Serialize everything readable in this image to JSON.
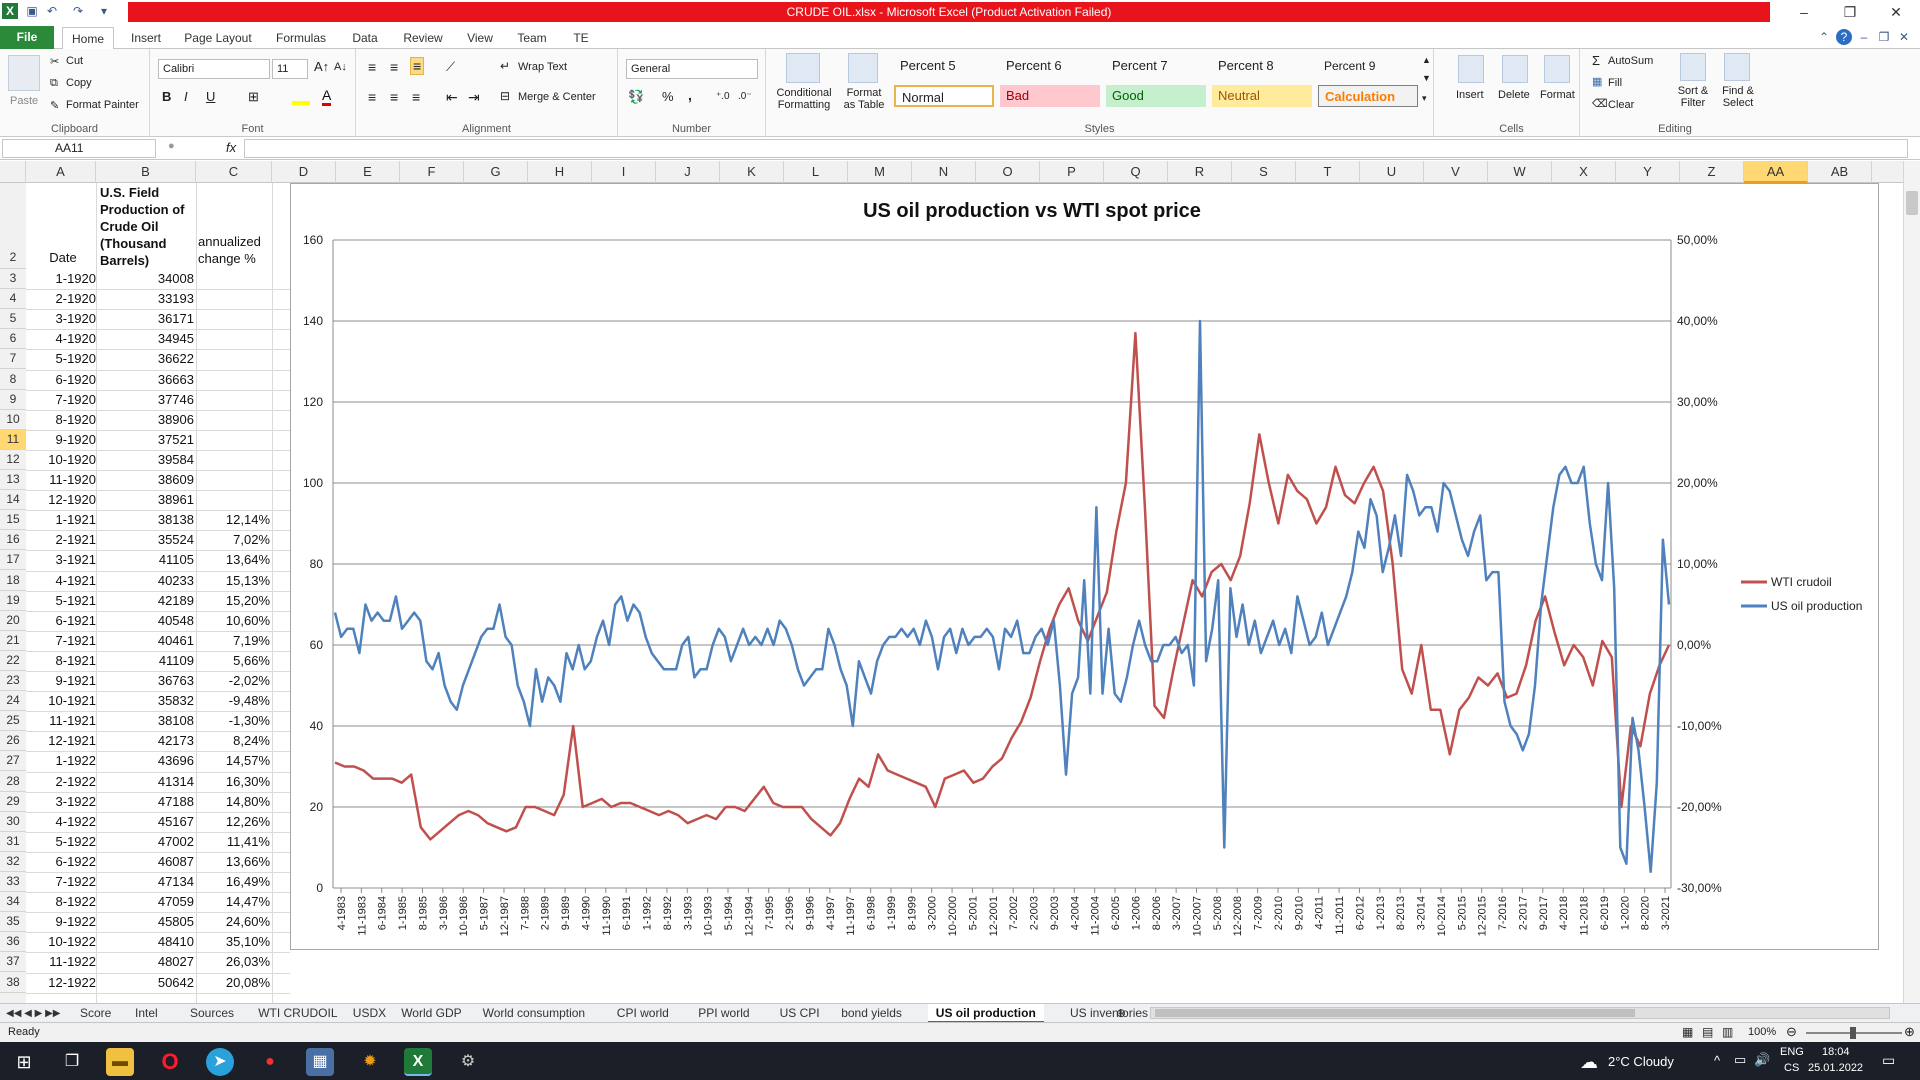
{
  "window": {
    "title": "CRUDE OIL.xlsx - Microsoft Excel (Product Activation Failed)",
    "controls": [
      "–",
      "❐",
      "✕"
    ]
  },
  "tabs": [
    "File",
    "Home",
    "Insert",
    "Page Layout",
    "Formulas",
    "Data",
    "Review",
    "View",
    "Team",
    "TE"
  ],
  "ribbon": {
    "clipboard": {
      "paste": "Paste",
      "cut": "Cut",
      "copy": "Copy",
      "format_painter": "Format Painter",
      "label": "Clipboard"
    },
    "font": {
      "name": "Calibri",
      "size": "11",
      "bold": "B",
      "italic": "I",
      "underline": "U",
      "label": "Font"
    },
    "alignment": {
      "wrap": "Wrap Text",
      "merge": "Merge & Center",
      "label": "Alignment"
    },
    "number": {
      "format": "General",
      "percent": "%",
      "comma": ",",
      "label": "Number"
    },
    "styles": {
      "conditional": "Conditional Formatting",
      "format_table": "Format as Table",
      "label": "Styles",
      "items": [
        {
          "name": "Percent 5",
          "bg": "#ffffff",
          "fg": "#111111"
        },
        {
          "name": "Percent 6",
          "bg": "#ffffff",
          "fg": "#111111"
        },
        {
          "name": "Percent 7",
          "bg": "#ffffff",
          "fg": "#111111"
        },
        {
          "name": "Percent 8",
          "bg": "#ffffff",
          "fg": "#111111"
        },
        {
          "name": "Percent 9",
          "bg": "#ffffff",
          "fg": "#111111"
        },
        {
          "name": "Normal",
          "bg": "#ffffff",
          "fg": "#111111"
        },
        {
          "name": "Bad",
          "bg": "#ffc7ce",
          "fg": "#9c0006"
        },
        {
          "name": "Good",
          "bg": "#c6efce",
          "fg": "#006100"
        },
        {
          "name": "Neutral",
          "bg": "#ffeb9c",
          "fg": "#9c5700"
        },
        {
          "name": "Calculation",
          "bg": "#f2f2f2",
          "fg": "#fa7d00"
        }
      ]
    },
    "cells": {
      "insert": "Insert",
      "delete": "Delete",
      "format": "Format",
      "label": "Cells"
    },
    "editing": {
      "autosum": "AutoSum",
      "fill": "Fill",
      "clear": "Clear",
      "sort": "Sort & Filter",
      "find": "Find & Select",
      "label": "Editing"
    }
  },
  "namebox": "AA11",
  "fx": "fx",
  "columns": [
    "A",
    "B",
    "C",
    "D",
    "E",
    "F",
    "G",
    "H",
    "I",
    "J",
    "K",
    "L",
    "M",
    "N",
    "O",
    "P",
    "Q",
    "R",
    "S",
    "T",
    "U",
    "V",
    "W",
    "X",
    "Y",
    "Z",
    "AA",
    "AB"
  ],
  "headers": {
    "A": "Date",
    "B": "U.S. Field Production of Crude Oil (Thousand Barrels)",
    "C": "annualized change %"
  },
  "rows": [
    {
      "n": "3",
      "a": "1-1920",
      "b": "34008",
      "c": ""
    },
    {
      "n": "4",
      "a": "2-1920",
      "b": "33193",
      "c": ""
    },
    {
      "n": "5",
      "a": "3-1920",
      "b": "36171",
      "c": ""
    },
    {
      "n": "6",
      "a": "4-1920",
      "b": "34945",
      "c": ""
    },
    {
      "n": "7",
      "a": "5-1920",
      "b": "36622",
      "c": ""
    },
    {
      "n": "8",
      "a": "6-1920",
      "b": "36663",
      "c": ""
    },
    {
      "n": "9",
      "a": "7-1920",
      "b": "37746",
      "c": ""
    },
    {
      "n": "10",
      "a": "8-1920",
      "b": "38906",
      "c": ""
    },
    {
      "n": "11",
      "a": "9-1920",
      "b": "37521",
      "c": ""
    },
    {
      "n": "12",
      "a": "10-1920",
      "b": "39584",
      "c": ""
    },
    {
      "n": "13",
      "a": "11-1920",
      "b": "38609",
      "c": ""
    },
    {
      "n": "14",
      "a": "12-1920",
      "b": "38961",
      "c": ""
    },
    {
      "n": "15",
      "a": "1-1921",
      "b": "38138",
      "c": "12,14%"
    },
    {
      "n": "16",
      "a": "2-1921",
      "b": "35524",
      "c": "7,02%"
    },
    {
      "n": "17",
      "a": "3-1921",
      "b": "41105",
      "c": "13,64%"
    },
    {
      "n": "18",
      "a": "4-1921",
      "b": "40233",
      "c": "15,13%"
    },
    {
      "n": "19",
      "a": "5-1921",
      "b": "42189",
      "c": "15,20%"
    },
    {
      "n": "20",
      "a": "6-1921",
      "b": "40548",
      "c": "10,60%"
    },
    {
      "n": "21",
      "a": "7-1921",
      "b": "40461",
      "c": "7,19%"
    },
    {
      "n": "22",
      "a": "8-1921",
      "b": "41109",
      "c": "5,66%"
    },
    {
      "n": "23",
      "a": "9-1921",
      "b": "36763",
      "c": "-2,02%"
    },
    {
      "n": "24",
      "a": "10-1921",
      "b": "35832",
      "c": "-9,48%"
    },
    {
      "n": "25",
      "a": "11-1921",
      "b": "38108",
      "c": "-1,30%"
    },
    {
      "n": "26",
      "a": "12-1921",
      "b": "42173",
      "c": "8,24%"
    },
    {
      "n": "27",
      "a": "1-1922",
      "b": "43696",
      "c": "14,57%"
    },
    {
      "n": "28",
      "a": "2-1922",
      "b": "41314",
      "c": "16,30%"
    },
    {
      "n": "29",
      "a": "3-1922",
      "b": "47188",
      "c": "14,80%"
    },
    {
      "n": "30",
      "a": "4-1922",
      "b": "45167",
      "c": "12,26%"
    },
    {
      "n": "31",
      "a": "5-1922",
      "b": "47002",
      "c": "11,41%"
    },
    {
      "n": "32",
      "a": "6-1922",
      "b": "46087",
      "c": "13,66%"
    },
    {
      "n": "33",
      "a": "7-1922",
      "b": "47134",
      "c": "16,49%"
    },
    {
      "n": "34",
      "a": "8-1922",
      "b": "47059",
      "c": "14,47%"
    },
    {
      "n": "35",
      "a": "9-1922",
      "b": "45805",
      "c": "24,60%"
    },
    {
      "n": "36",
      "a": "10-1922",
      "b": "48410",
      "c": "35,10%"
    },
    {
      "n": "37",
      "a": "11-1922",
      "b": "48027",
      "c": "26,03%"
    },
    {
      "n": "38",
      "a": "12-1922",
      "b": "50642",
      "c": "20,08%"
    }
  ],
  "chart_data": {
    "type": "line",
    "title": "US oil production vs WTI spot price",
    "y_left": {
      "min": 0,
      "max": 160,
      "ticks": [
        "0",
        "20",
        "40",
        "60",
        "80",
        "100",
        "120",
        "140",
        "160"
      ]
    },
    "y_right": {
      "min": -30,
      "max": 50,
      "ticks": [
        "-30,00%",
        "-20,00%",
        "-10,00%",
        "0,00%",
        "10,00%",
        "20,00%",
        "30,00%",
        "40,00%",
        "50,00%"
      ]
    },
    "x_tick_labels": [
      "4-1983",
      "11-1983",
      "6-1984",
      "1-1985",
      "8-1985",
      "3-1986",
      "10-1986",
      "5-1987",
      "12-1987",
      "7-1988",
      "2-1989",
      "9-1989",
      "4-1990",
      "11-1990",
      "6-1991",
      "1-1992",
      "8-1992",
      "3-1993",
      "10-1993",
      "5-1994",
      "12-1994",
      "7-1995",
      "2-1996",
      "9-1996",
      "4-1997",
      "11-1997",
      "6-1998",
      "1-1999",
      "8-1999",
      "3-2000",
      "10-2000",
      "5-2001",
      "12-2001",
      "7-2002",
      "2-2003",
      "9-2003",
      "4-2004",
      "11-2004",
      "6-2005",
      "1-2006",
      "8-2006",
      "3-2007",
      "10-2007",
      "5-2008",
      "12-2008",
      "7-2009",
      "2-2010",
      "9-2010",
      "4-2011",
      "11-2011",
      "6-2012",
      "1-2013",
      "8-2013",
      "3-2014",
      "10-2014",
      "5-2015",
      "12-2015",
      "7-2016",
      "2-2017",
      "9-2017",
      "4-2018",
      "11-2018",
      "6-2019",
      "1-2020",
      "8-2020",
      "3-2021"
    ],
    "series": [
      {
        "name": "WTI crudoil",
        "color": "#c0504d",
        "axis": "left",
        "values": [
          31,
          30,
          30,
          29,
          27,
          27,
          27,
          26,
          28,
          15,
          12,
          14,
          16,
          18,
          19,
          18,
          16,
          15,
          14,
          15,
          20,
          20,
          19,
          18,
          23,
          40,
          20,
          21,
          22,
          20,
          21,
          21,
          20,
          19,
          18,
          19,
          18,
          16,
          17,
          18,
          17,
          20,
          20,
          19,
          22,
          25,
          21,
          20,
          20,
          20,
          17,
          15,
          13,
          16,
          22,
          27,
          25,
          33,
          29,
          28,
          27,
          26,
          25,
          20,
          27,
          28,
          29,
          26,
          27,
          30,
          32,
          37,
          41,
          47,
          56,
          64,
          70,
          74,
          66,
          61,
          67,
          73,
          88,
          100,
          137,
          94,
          45,
          42,
          54,
          65,
          76,
          72,
          78,
          80,
          76,
          82,
          95,
          112,
          100,
          90,
          102,
          98,
          96,
          90,
          94,
          104,
          97,
          95,
          100,
          104,
          98,
          80,
          54,
          48,
          60,
          44,
          44,
          33,
          44,
          47,
          52,
          50,
          53,
          47,
          48,
          55,
          66,
          72,
          63,
          55,
          60,
          57,
          50,
          61,
          57,
          20,
          40,
          35,
          48,
          55,
          60
        ]
      },
      {
        "name": "US oil production",
        "color": "#4f81bd",
        "axis": "right",
        "values": [
          4,
          1,
          2,
          2,
          -1,
          5,
          3,
          4,
          3,
          3,
          6,
          2,
          3,
          4,
          3,
          -2,
          -3,
          -1,
          -5,
          -7,
          -8,
          -5,
          -3,
          -1,
          1,
          2,
          2,
          5,
          1,
          0,
          -5,
          -7,
          -10,
          -3,
          -7,
          -4,
          -5,
          -7,
          -1,
          -3,
          0,
          -3,
          -2,
          1,
          3,
          0,
          5,
          6,
          3,
          5,
          4,
          1,
          -1,
          -2,
          -3,
          -3,
          -3,
          0,
          1,
          -4,
          -3,
          -3,
          0,
          2,
          1,
          -2,
          0,
          2,
          0,
          1,
          0,
          2,
          0,
          3,
          2,
          0,
          -3,
          -5,
          -4,
          -3,
          -3,
          2,
          0,
          -3,
          -5,
          -10,
          -2,
          -4,
          -6,
          -2,
          0,
          1,
          1,
          2,
          1,
          2,
          0,
          3,
          1,
          -3,
          1,
          2,
          -1,
          2,
          0,
          1,
          1,
          2,
          1,
          -3,
          2,
          1,
          3,
          -1,
          -1,
          1,
          2,
          0,
          3,
          -5,
          -16,
          -6,
          -4,
          8,
          -6,
          17,
          -6,
          2,
          -6,
          -7,
          -4,
          0,
          3,
          0,
          -2,
          -2,
          0,
          0,
          1,
          -1,
          0,
          -5,
          40,
          -2,
          2,
          8,
          -25,
          7,
          1,
          5,
          0,
          3,
          -1,
          1,
          3,
          0,
          2,
          -1,
          6,
          3,
          0,
          1,
          4,
          0,
          2,
          4,
          6,
          9,
          14,
          12,
          18,
          16,
          9,
          12,
          16,
          11,
          21,
          19,
          16,
          17,
          17,
          14,
          20,
          19,
          16,
          13,
          11,
          14,
          16,
          8,
          9,
          9,
          -7,
          -10,
          -11,
          -13,
          -11,
          -5,
          5,
          11,
          17,
          21,
          22,
          20,
          20,
          22,
          15,
          10,
          8,
          20,
          7,
          -25,
          -27,
          -9,
          -13,
          -20,
          -28,
          -17,
          13,
          5
        ]
      }
    ],
    "legend": {
      "position": "right"
    }
  },
  "sheet_tabs": [
    "Score",
    "Intel",
    "Sources",
    "WTI CRUDOIL",
    "USDX",
    "World GDP",
    "World consumption",
    "CPI world",
    "PPI world",
    "US CPI",
    "bond yields",
    "US oil production",
    "US inventories"
  ],
  "active_sheet": "US oil production",
  "status": {
    "ready": "Ready",
    "zoom": "100%"
  },
  "taskbar": {
    "weather": "2°C  Cloudy",
    "lang": "ENG",
    "lang2": "CS",
    "time": "18:04",
    "date": "25.01.2022"
  }
}
